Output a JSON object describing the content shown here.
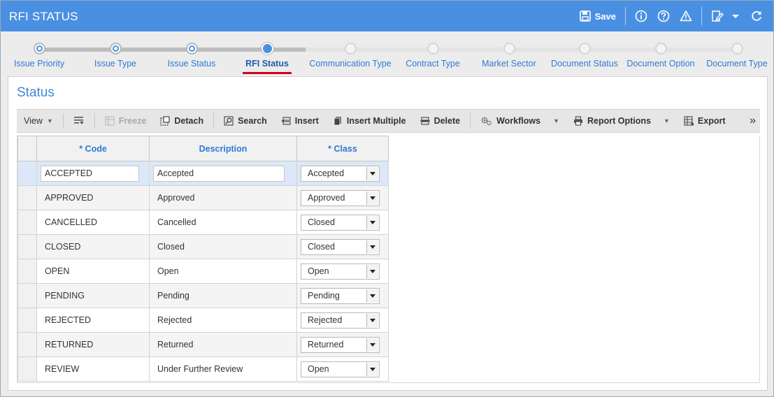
{
  "header": {
    "title": "RFI STATUS",
    "save_label": "Save",
    "bg_color": "#4a90e2"
  },
  "wizard": {
    "steps": [
      {
        "label": "Issue Priority",
        "state": "done"
      },
      {
        "label": "Issue Type",
        "state": "done"
      },
      {
        "label": "Issue Status",
        "state": "done"
      },
      {
        "label": "RFI Status",
        "state": "active"
      },
      {
        "label": "Communication Type",
        "state": "todo"
      },
      {
        "label": "Contract Type",
        "state": "todo"
      },
      {
        "label": "Market Sector",
        "state": "todo"
      },
      {
        "label": "Document Status",
        "state": "todo"
      },
      {
        "label": "Document Option",
        "state": "todo"
      },
      {
        "label": "Document Type",
        "state": "todo"
      }
    ]
  },
  "panel": {
    "title": "Status"
  },
  "toolbar": {
    "view": "View",
    "freeze": "Freeze",
    "detach": "Detach",
    "search": "Search",
    "insert": "Insert",
    "insert_multiple": "Insert Multiple",
    "delete": "Delete",
    "workflows": "Workflows",
    "report_options": "Report Options",
    "export": "Export",
    "more": "»"
  },
  "grid": {
    "columns": [
      "* Code",
      "Description",
      "* Class"
    ],
    "rows": [
      {
        "code": "ACCEPTED",
        "description": "Accepted",
        "class": "Accepted",
        "editing": true
      },
      {
        "code": "APPROVED",
        "description": "Approved",
        "class": "Approved"
      },
      {
        "code": "CANCELLED",
        "description": "Cancelled",
        "class": "Closed"
      },
      {
        "code": "CLOSED",
        "description": "Closed",
        "class": "Closed"
      },
      {
        "code": "OPEN",
        "description": "Open",
        "class": "Open"
      },
      {
        "code": "PENDING",
        "description": "Pending",
        "class": "Pending"
      },
      {
        "code": "REJECTED",
        "description": "Rejected",
        "class": "Rejected"
      },
      {
        "code": "RETURNED",
        "description": "Returned",
        "class": "Returned"
      },
      {
        "code": "REVIEW",
        "description": "Under Further Review",
        "class": "Open"
      }
    ]
  }
}
